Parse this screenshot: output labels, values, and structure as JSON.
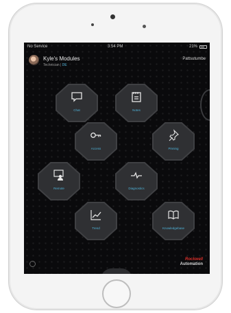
{
  "statusbar": {
    "carrier": "No Service",
    "time": "3:54 PM",
    "battery": "21%"
  },
  "header": {
    "user_name": "Kyle's Modules",
    "subtitle_prefix": "Technician",
    "subtitle_accent": "DE",
    "link": "Pattsutumbe"
  },
  "tiles": [
    {
      "label": "Chat",
      "icon": "chat-bubble-icon"
    },
    {
      "label": "Notes",
      "icon": "notepad-icon"
    },
    {
      "label": "Access",
      "icon": "key-icon"
    },
    {
      "label": "Pinning",
      "icon": "pushpin-icon"
    },
    {
      "label": "Remote",
      "icon": "remote-user-icon"
    },
    {
      "label": "Diagnostics",
      "icon": "heartbeat-icon"
    },
    {
      "label": "Trend",
      "icon": "trend-chart-icon"
    },
    {
      "label": "Knowledgebase",
      "icon": "open-book-icon"
    }
  ],
  "brand": {
    "top": "Rockwell",
    "bottom": "Automation"
  },
  "colors": {
    "accent": "#4fb3d9",
    "tile": "#2f3033",
    "brand_red": "#d9302b",
    "screen_bg": "#0a0a0c"
  }
}
